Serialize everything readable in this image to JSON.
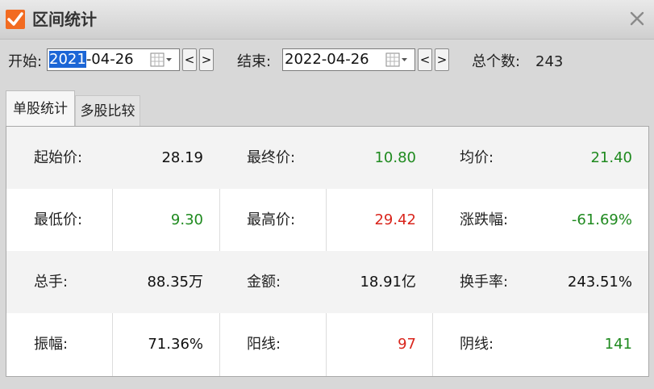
{
  "window": {
    "title": "区间统计"
  },
  "toolbar": {
    "start_label": "开始:",
    "start_date_selected": "2021",
    "start_date_rest": "-04-26",
    "end_label": "结束:",
    "end_date": "2022-04-26",
    "prev": "<",
    "next": ">",
    "count_label": "总个数:",
    "count_value": "243"
  },
  "tabs": [
    {
      "label": "单股统计",
      "active": true
    },
    {
      "label": "多股比较",
      "active": false
    }
  ],
  "stats": [
    [
      {
        "key": "起始价:",
        "value": "28.19",
        "color": "dark"
      },
      {
        "key": "最终价:",
        "value": "10.80",
        "color": "green"
      },
      {
        "key": "均价:",
        "value": "21.40",
        "color": "green"
      }
    ],
    [
      {
        "key": "最低价:",
        "value": "9.30",
        "color": "green"
      },
      {
        "key": "最高价:",
        "value": "29.42",
        "color": "red"
      },
      {
        "key": "涨跌幅:",
        "value": "-61.69%",
        "color": "green"
      }
    ],
    [
      {
        "key": "总手:",
        "value": "88.35万",
        "color": "dark"
      },
      {
        "key": "金额:",
        "value": "18.91亿",
        "color": "dark"
      },
      {
        "key": "换手率:",
        "value": "243.51%",
        "color": "dark"
      }
    ],
    [
      {
        "key": "振幅:",
        "value": "71.36%",
        "color": "dark"
      },
      {
        "key": "阳线:",
        "value": "97",
        "color": "red"
      },
      {
        "key": "阴线:",
        "value": "141",
        "color": "green"
      }
    ]
  ],
  "colors": {
    "green": "#1f8a1f",
    "red": "#d9251c",
    "accent": "#f26b21",
    "selection": "#1c66d6"
  },
  "icons": [
    "check-logo-icon",
    "close-icon",
    "calendar-icon",
    "dropdown-arrow-icon"
  ]
}
